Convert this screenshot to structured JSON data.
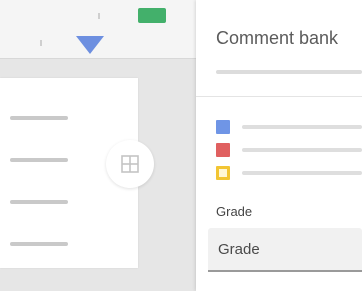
{
  "panel": {
    "title": "Comment bank",
    "color_rows": [
      {
        "color": "#6f95e6"
      },
      {
        "color": "#e06060"
      },
      {
        "color": "#f2c533"
      }
    ],
    "grade_label": "Grade",
    "grade_value": "Grade"
  },
  "colors": {
    "toolbar_chip": "#43b06b",
    "accent_triangle": "#6d8fe0"
  },
  "icons": {
    "center_button": "grid-icon"
  }
}
